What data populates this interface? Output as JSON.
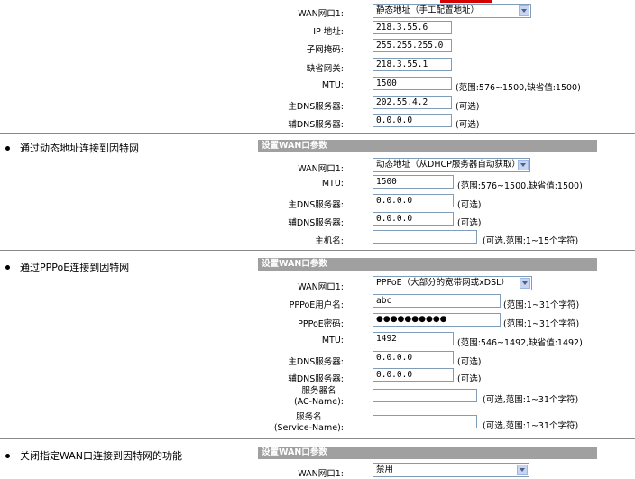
{
  "static": {
    "wan_port_label": "WAN网口1:",
    "wan_port_value": "静态地址（手工配置地址）",
    "ip_label": "IP 地址:",
    "ip_value": "218.3.55.6",
    "mask_label": "子网掩码:",
    "mask_value": "255.255.255.0",
    "gateway_label": "缺省网关:",
    "gateway_value": "218.3.55.1",
    "mtu_label": "MTU:",
    "mtu_value": "1500",
    "mtu_hint": "(范围:576~1500,缺省值:1500)",
    "dns1_label": "主DNS服务器:",
    "dns1_value": "202.55.4.2",
    "dns1_hint": "(可选)",
    "dns2_label": "辅DNS服务器:",
    "dns2_value": "0.0.0.0",
    "dns2_hint": "(可选)"
  },
  "dynamic": {
    "bullet": "通过动态地址连接到因特网",
    "header": "设置WAN口参数",
    "wan_port_label": "WAN网口1:",
    "wan_port_value": "动态地址（从DHCP服务器自动获取）",
    "mtu_label": "MTU:",
    "mtu_value": "1500",
    "mtu_hint": "(范围:576~1500,缺省值:1500)",
    "dns1_label": "主DNS服务器:",
    "dns1_value": "0.0.0.0",
    "dns1_hint": "(可选)",
    "dns2_label": "辅DNS服务器:",
    "dns2_value": "0.0.0.0",
    "dns2_hint": "(可选)",
    "host_label": "主机名:",
    "host_value": "",
    "host_hint": "(可选,范围:1~15个字符)"
  },
  "pppoe": {
    "bullet": "通过PPPoE连接到因特网",
    "header": "设置WAN口参数",
    "wan_port_label": "WAN网口1:",
    "wan_port_value": "PPPoE（大部分的宽带网或xDSL）",
    "user_label": "PPPoE用户名:",
    "user_value": "abc",
    "user_hint": "(范围:1~31个字符)",
    "pass_label": "PPPoE密码:",
    "pass_value": "●●●●●●●●●●",
    "pass_hint": "(范围:1~31个字符)",
    "mtu_label": "MTU:",
    "mtu_value": "1492",
    "mtu_hint": "(范围:546~1492,缺省值:1492)",
    "dns1_label": "主DNS服务器:",
    "dns1_value": "0.0.0.0",
    "dns1_hint": "(可选)",
    "dns2_label": "辅DNS服务器:",
    "dns2_value": "0.0.0.0",
    "dns2_hint": "(可选)",
    "ac_label_line1": "服务器名",
    "ac_label_line2": "(AC-Name):",
    "ac_value": "",
    "ac_hint": "(可选,范围:1~31个字符)",
    "svc_label_line1": "服务名",
    "svc_label_line2": "(Service-Name):",
    "svc_value": "",
    "svc_hint": "(可选,范围:1~31个字符)"
  },
  "disabled": {
    "bullet": "关闭指定WAN口连接到因特网的功能",
    "header": "设置WAN口参数",
    "wan_port_label": "WAN网口1:",
    "wan_port_value": "禁用"
  }
}
